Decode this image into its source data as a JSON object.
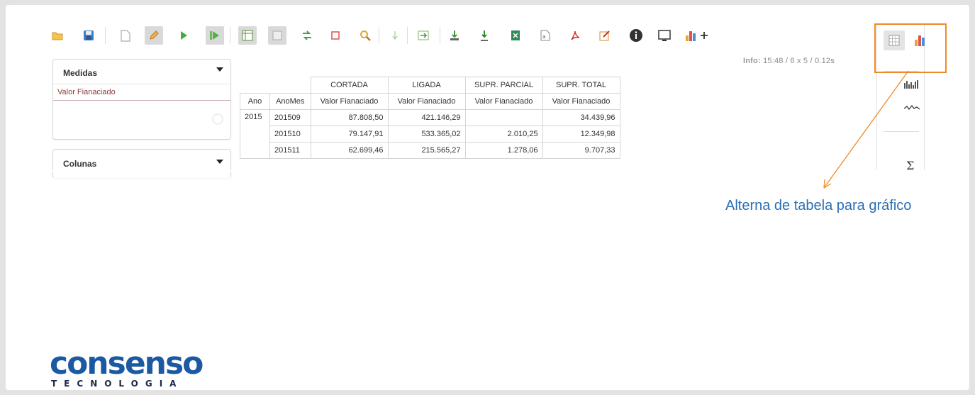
{
  "info": {
    "label": "Info:",
    "value": "15:48  / 6 x 5 / 0.12s"
  },
  "panels": {
    "medidas": {
      "title": "Medidas",
      "items": [
        "Valor Fianaciado"
      ]
    },
    "colunas": {
      "title": "Colunas"
    }
  },
  "table": {
    "col_groups": [
      "CORTADA",
      "LIGADA",
      "SUPR. PARCIAL",
      "SUPR. TOTAL"
    ],
    "row_headers": [
      "Ano",
      "AnoMes"
    ],
    "measure": "Valor Fianaciado",
    "year": "2015",
    "rows": [
      {
        "anomes": "201509",
        "values": [
          "87.808,50",
          "421.146,29",
          "",
          "34.439,96"
        ]
      },
      {
        "anomes": "201510",
        "values": [
          "79.147,91",
          "533.365,02",
          "2.010,25",
          "12.349,98"
        ]
      },
      {
        "anomes": "201511",
        "values": [
          "62.699,46",
          "215.565,27",
          "1.278,06",
          "9.707,33"
        ]
      }
    ]
  },
  "annotation": "Alterna de tabela para gráfico",
  "logo": {
    "main": "consenso",
    "sub": "TECNOLOGIA"
  },
  "colors": {
    "accent_orange": "#ee8a2a",
    "annotation_blue": "#2a6fb6",
    "logo_blue": "#1b5aa3",
    "item_red": "#8b3a3a"
  },
  "toolbar_icons": [
    "open-folder-icon",
    "save-disk-icon",
    "new-document-icon",
    "edit-pencil-icon",
    "play-icon",
    "run-all-icon",
    "pivot-table-icon",
    "hide-empty-icon",
    "swap-axis-icon",
    "refresh-icon",
    "search-icon",
    "sort-down-icon",
    "export-arrow-icon",
    "download-icon",
    "download-alt-icon",
    "excel-icon",
    "csv-icon",
    "pdf-icon",
    "report-icon",
    "info-icon",
    "fullscreen-icon",
    "add-chart-icon"
  ]
}
